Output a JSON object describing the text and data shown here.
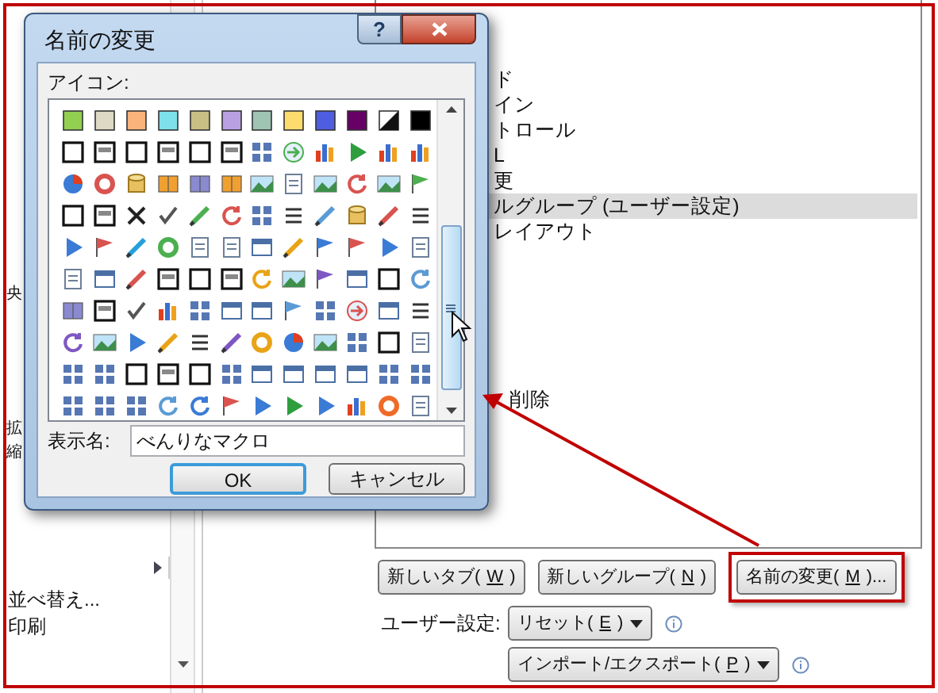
{
  "left_panel": {
    "items": [
      "央",
      "拡",
      "縮",
      "並べ替え...",
      "印刷"
    ]
  },
  "list": {
    "items": [
      {
        "text": "ド",
        "selected": false
      },
      {
        "text": "イン",
        "selected": false
      },
      {
        "text": "トロール",
        "selected": false
      },
      {
        "text": "L",
        "selected": false
      },
      {
        "text": "更",
        "selected": false
      },
      {
        "text": "ルグループ (ユーザー設定)",
        "selected": true
      },
      {
        "text": "レイアウト",
        "selected": false
      }
    ],
    "lower_items": [
      "削除"
    ]
  },
  "buttons": [
    {
      "before": "新しいタブ(",
      "key": "W",
      "after": ")",
      "highlighted": false
    },
    {
      "before": "新しいグループ(",
      "key": "N",
      "after": ")",
      "highlighted": false
    },
    {
      "before": "名前の変更(",
      "key": "M",
      "after": ")...",
      "highlighted": true
    }
  ],
  "settings": {
    "label": "ユーザー設定:",
    "reset": {
      "before": "リセット(",
      "key": "E",
      "after": ")"
    },
    "import_export": {
      "before": "インポート/エクスポート(",
      "key": "P",
      "after": ")"
    }
  },
  "dialog": {
    "title": "名前の変更",
    "help": "?",
    "icon_label": "アイコン:",
    "name_label": "表示名:",
    "name_value": "べんりなマクロ",
    "ok": "OK",
    "cancel": "キャンセル"
  }
}
